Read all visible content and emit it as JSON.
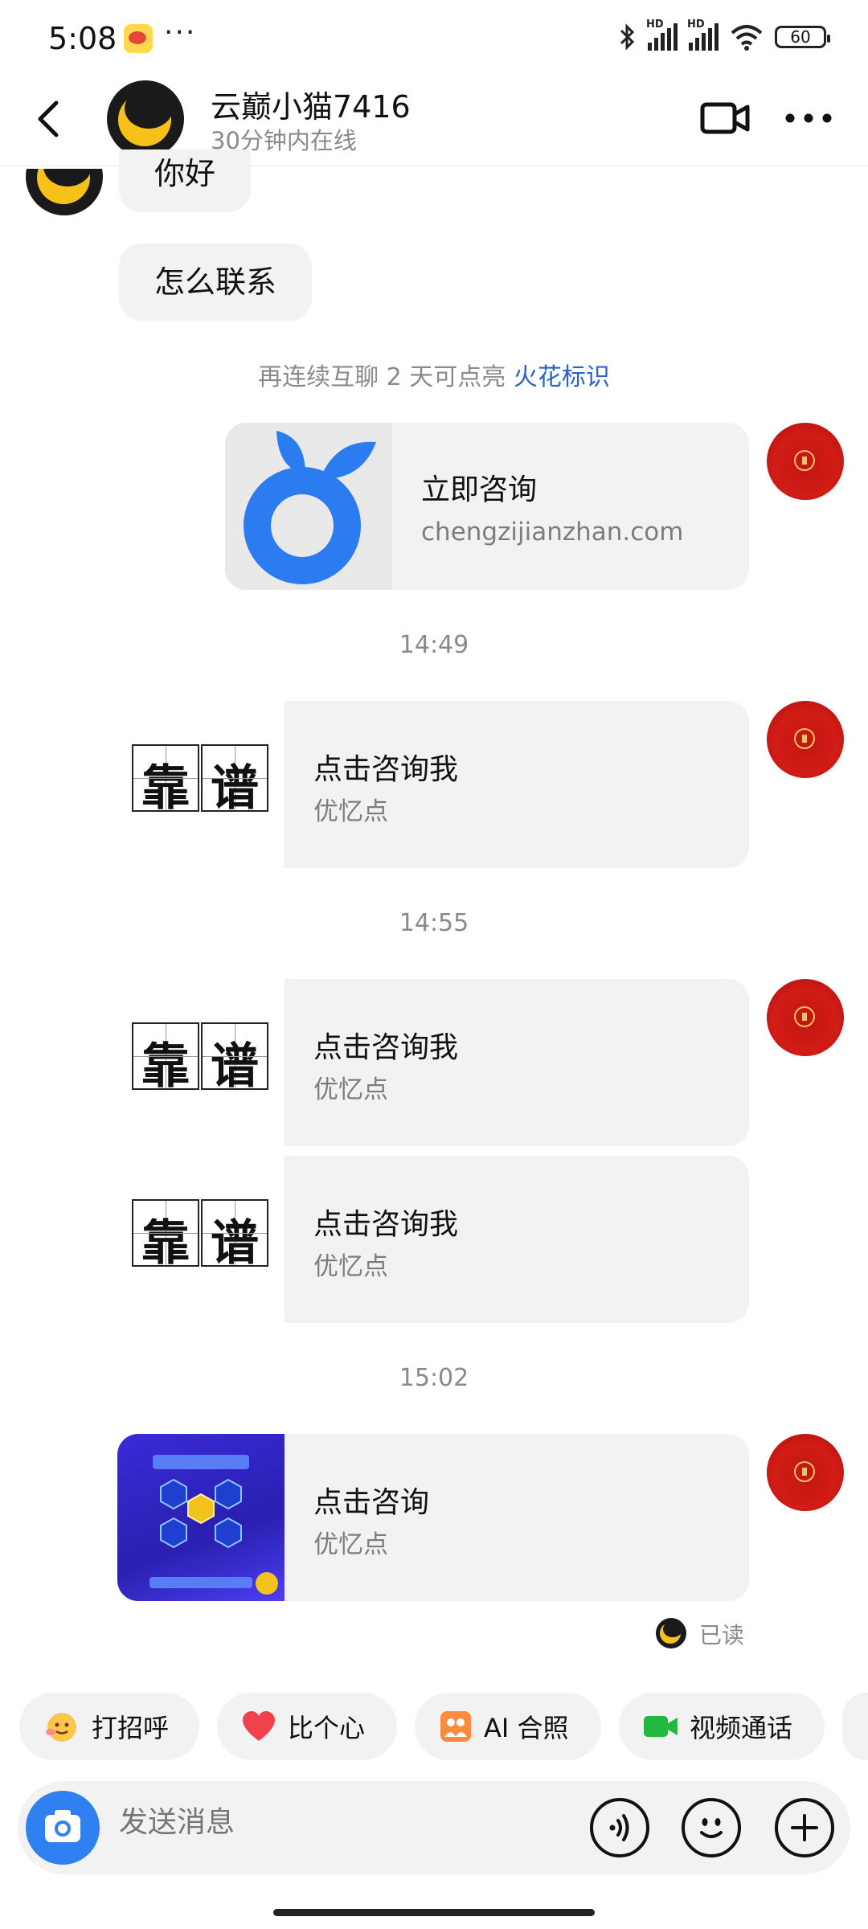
{
  "status_bar": {
    "time": "5:08",
    "dots": "···",
    "net1": "HD",
    "net2": "HD",
    "battery": "60"
  },
  "header": {
    "contact_name": "云巅小猫7416",
    "online_status": "30分钟内在线"
  },
  "messages": {
    "greeting": "你好",
    "how_contact": "怎么联系",
    "spark_prefix": "再连续互聊 2 天可点亮 ",
    "spark_link": "火花标识",
    "link_card": {
      "title": "立即咨询",
      "url": "chengzijianzhan.com"
    },
    "time1": "14:49",
    "card1": {
      "title": "点击咨询我",
      "subtitle": "优忆点",
      "char1": "靠",
      "char2": "谱"
    },
    "time2": "14:55",
    "card2": {
      "title": "点击咨询我",
      "subtitle": "优忆点",
      "char1": "靠",
      "char2": "谱"
    },
    "card3": {
      "title": "点击咨询我",
      "subtitle": "优忆点",
      "char1": "靠",
      "char2": "谱"
    },
    "time3": "15:02",
    "card4": {
      "title": "点击咨询",
      "subtitle": "优忆点"
    },
    "read_status": "已读"
  },
  "quick_replies": [
    "打招呼",
    "比个心",
    "AI 合照",
    "视频通话"
  ],
  "input": {
    "placeholder": "发送消息"
  },
  "colors": {
    "link": "#2b62c9",
    "camera": "#2f80f0",
    "bubble": "#f2f2f2",
    "seal": "#d21c16"
  }
}
